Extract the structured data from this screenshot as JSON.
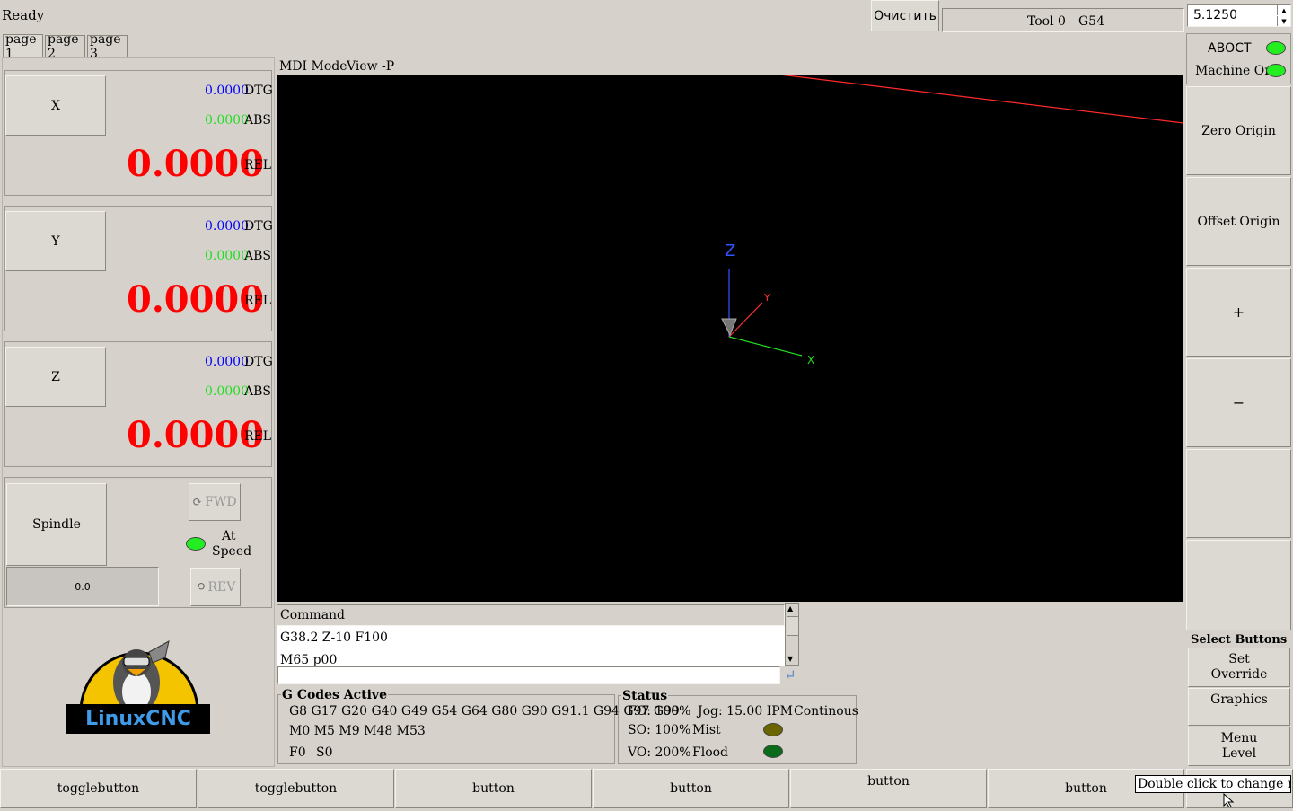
{
  "topbar": {
    "status": "Ready",
    "clear_label": "Очистить",
    "tool": "Tool 0",
    "offset": "G54",
    "spin_value": "5.1250"
  },
  "tabs": [
    "page 1",
    "page 2",
    "page 3"
  ],
  "axes": [
    {
      "name": "X",
      "dtg": "0.0000",
      "dtg_label": "DTG",
      "abs": "0.0000",
      "abs_label": "ABS",
      "rel": "0.0000",
      "rel_label": "REL"
    },
    {
      "name": "Y",
      "dtg": "0.0000",
      "dtg_label": "DTG",
      "abs": "0.0000",
      "abs_label": "ABS",
      "rel": "0.0000",
      "rel_label": "REL"
    },
    {
      "name": "Z",
      "dtg": "0.0000",
      "dtg_label": "DTG",
      "abs": "0.0000",
      "abs_label": "ABS",
      "rel": "0.0000",
      "rel_label": "REL"
    }
  ],
  "spindle": {
    "label": "Spindle",
    "fwd": "FWD",
    "rev": "REV",
    "at_speed_1": "At",
    "at_speed_2": "Speed",
    "speed_value": "0.0",
    "at_speed_color": "#22ee22"
  },
  "logo": {
    "text": "LinuxCNC"
  },
  "viewer": {
    "mode": "MDI Mode",
    "view": "View -P",
    "axis_labels": {
      "z": "Z",
      "y": "Y",
      "x": "X"
    }
  },
  "command": {
    "header": "Command",
    "history": [
      "G38.2 Z-10 F100",
      "M65 p00"
    ],
    "input_value": ""
  },
  "gcodes": {
    "title": "G Codes Active",
    "line1": "G8 G17 G20 G40 G49 G54 G64 G80 G90 G91.1 G94 G97 G99",
    "line2": "M0 M5 M9 M48 M53",
    "line3_f": "F0",
    "line3_s": "S0"
  },
  "status": {
    "title": "Status",
    "fo": "FO: 100%",
    "jog": "Jog: 15.00 IPM",
    "jog_mode": "Continous",
    "so": "SO: 100%",
    "mist": "Mist",
    "vo": "VO: 200%",
    "flood": "Flood",
    "mist_color": "#6b6500",
    "flood_color": "#0b6b1a"
  },
  "right": {
    "estop_label": "АВОСТ",
    "machine_on_label": "Machine On",
    "led_color": "#22ee22",
    "zero_origin": "Zero Origin",
    "offset_origin": "Offset Origin",
    "plus": "+",
    "minus": "−",
    "select_buttons": "Select Buttons",
    "set_override_1": "Set",
    "set_override_2": "Override",
    "graphics": "Graphics",
    "menu_level_1": "Menu",
    "menu_level_2": "Level"
  },
  "bottom": [
    "togglebutton",
    "togglebutton",
    "button",
    "button",
    "button",
    "button"
  ],
  "tooltip": "Double click to change mode"
}
